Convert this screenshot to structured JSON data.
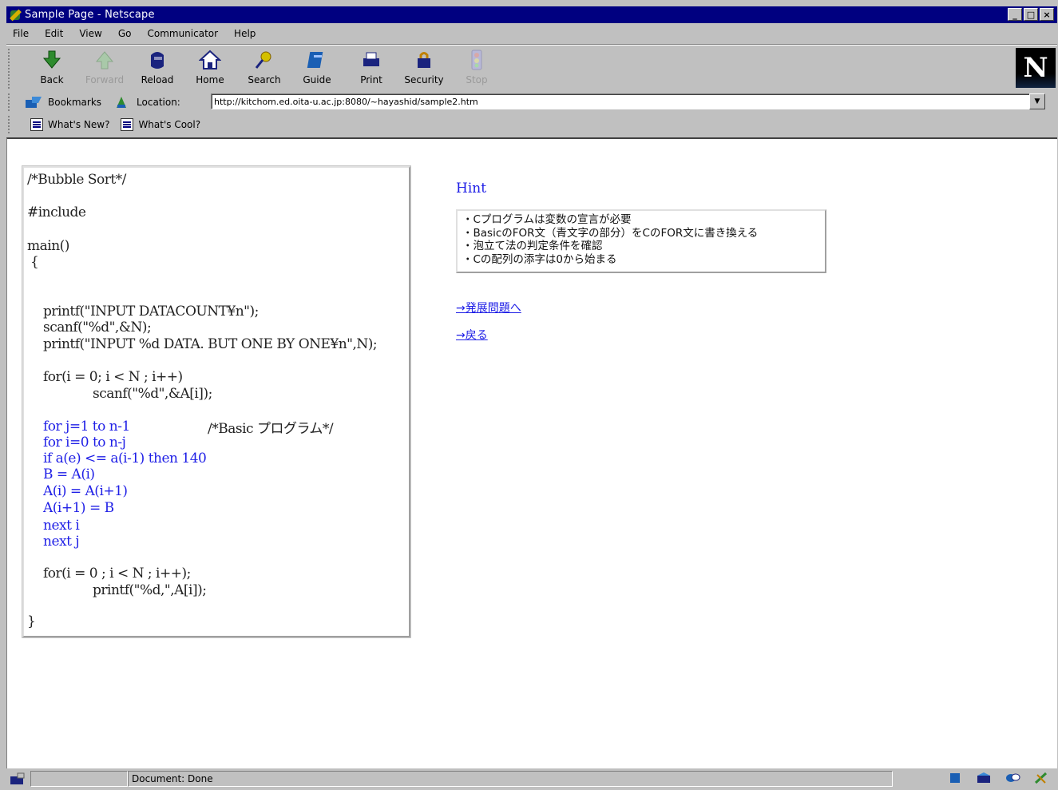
{
  "window": {
    "title": "Sample Page - Netscape",
    "controls": [
      "_",
      "□",
      "×"
    ]
  },
  "menu": [
    "File",
    "Edit",
    "View",
    "Go",
    "Communicator",
    "Help"
  ],
  "toolbar": {
    "buttons": [
      {
        "label": "Back",
        "icon": "back-arrow-icon",
        "enabled": true
      },
      {
        "label": "Forward",
        "icon": "forward-arrow-icon",
        "enabled": false
      },
      {
        "label": "Reload",
        "icon": "reload-icon",
        "enabled": true
      },
      {
        "label": "Home",
        "icon": "home-icon",
        "enabled": true
      },
      {
        "label": "Search",
        "icon": "search-icon",
        "enabled": true
      },
      {
        "label": "Guide",
        "icon": "guide-icon",
        "enabled": true
      },
      {
        "label": "Print",
        "icon": "print-icon",
        "enabled": true
      },
      {
        "label": "Security",
        "icon": "security-lock-icon",
        "enabled": true
      },
      {
        "label": "Stop",
        "icon": "stop-icon",
        "enabled": false
      }
    ],
    "logo": "N"
  },
  "location": {
    "bookmarks_label": "Bookmarks",
    "label": "Location:",
    "url": "http://kitchom.ed.oita-u.ac.jp:8080/~hayashid/sample2.htm"
  },
  "personal_toolbar": [
    "What's New?",
    "What's Cool?"
  ],
  "code": {
    "lines": [
      "/*Bubble Sort*/",
      "#include",
      "main()",
      "{",
      "printf(\"INPUT DATACOUNT¥n\");",
      "scanf(\"%d\",&N);",
      "printf(\"INPUT %d DATA. BUT ONE BY ONE¥n\",N);",
      "for(i = 0; i < N ; i++)",
      "scanf(\"%d\",&A[i]);",
      "for j=1 to n-1",
      "/*Basic プログラム*/",
      "for i=0 to n-j",
      "if a(e) <= a(i-1) then 140",
      "B = A(i)",
      "A(i) = A(i+1)",
      "A(i+1) = B",
      "next i",
      "next j",
      "for(i = 0 ; i < N ; i++);",
      "printf(\"%d,\",A[i]);",
      "}"
    ]
  },
  "hint": {
    "title": "Hint",
    "items": [
      "・Cプログラムは変数の宣言が必要",
      "・BasicのFOR文（青文字の部分）をCのFOR文に書き換える",
      "・泡立て法の判定条件を確認",
      "・Cの配列の添字は0から始まる"
    ]
  },
  "links": {
    "advanced": "→発展問題へ",
    "back": "→戻る"
  },
  "status": {
    "text": "Document: Done"
  }
}
